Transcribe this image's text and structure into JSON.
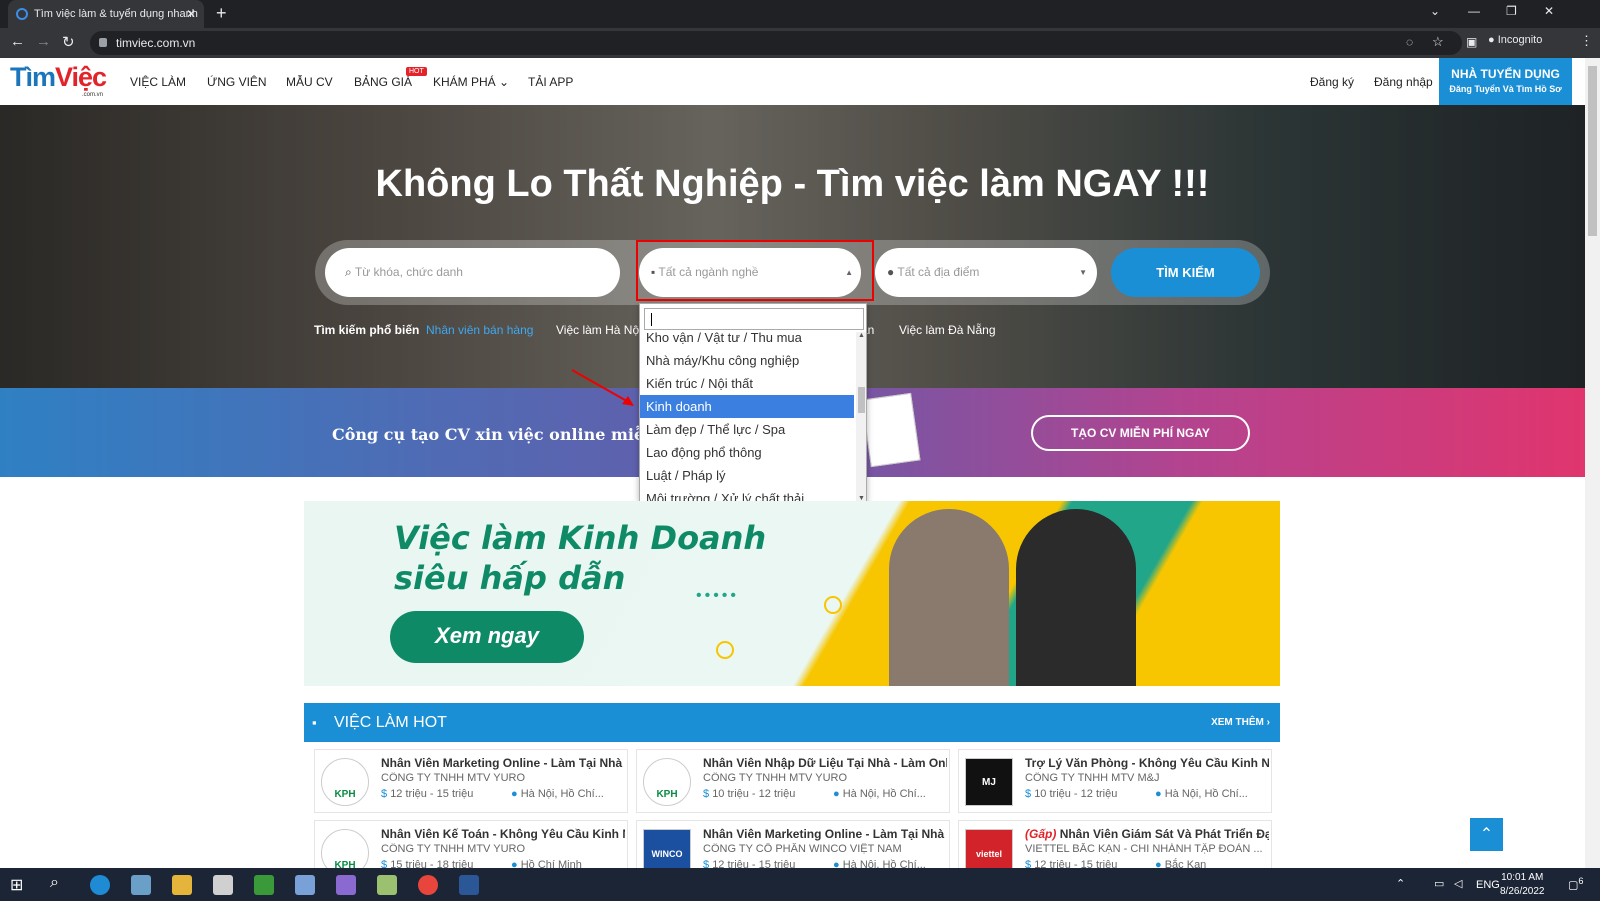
{
  "browser": {
    "tab_title": "Tìm việc làm & tuyển dụng nhanh",
    "tab_close": "✕",
    "new_tab": "+",
    "url": "timviec.com.vn",
    "incognito_label": "Incognito"
  },
  "header": {
    "logo_part1": "Tìm",
    "logo_part2": "Việc",
    "logo_sub": ".com.vn",
    "menu": [
      "VIỆC LÀM",
      "ỨNG VIÊN",
      "MẪU CV",
      "BẢNG GIÁ",
      "KHÁM PHÁ",
      "TẢI APP"
    ],
    "hot_badge": "HOT",
    "register": "Đăng ký",
    "login": "Đăng nhập",
    "employer_title": "NHÀ TUYỂN DỤNG",
    "employer_sub": "Đăng Tuyển Và Tìm Hồ Sơ"
  },
  "hero": {
    "title": "Không Lo Thất Nghiệp - Tìm việc làm NGAY !!!",
    "keyword_placeholder": "Từ khóa, chức danh",
    "industry_placeholder": "Tất cả ngành nghề",
    "location_placeholder": "Tất cả địa điểm",
    "search_button": "TÌM KIẾM",
    "popular_label": "Tìm kiếm phổ biến",
    "popular_links": [
      "Nhân viên bán hàng",
      "Việc làm Hà Nội",
      "ân",
      "Việc làm Đà Nẵng"
    ]
  },
  "industry_dropdown": {
    "items": [
      "Kho vận / Vật tư / Thu mua",
      "Nhà máy/Khu công nghiệp",
      "Kiến trúc / Nội thất",
      "Kinh doanh",
      "Làm đẹp / Thể lực / Spa",
      "Lao động phổ thông",
      "Luật / Pháp lý",
      "Môi trường / Xử lý chất thải"
    ],
    "selected_index": 3
  },
  "cv_banner": {
    "text": "Công cụ tạo CV xin việc online miễn phí,",
    "button": "TẠO CV MIỄN PHÍ NGAY"
  },
  "ad": {
    "line1": "Việc làm Kinh Doanh",
    "line2": "siêu hấp dẫn",
    "button": "Xem ngay"
  },
  "hot_jobs": {
    "title": "VIỆC LÀM HOT",
    "more": "XEM THÊM",
    "jobs": [
      {
        "title": "Nhân Viên Marketing Online - Làm Tại Nhà (...",
        "company": "CÔNG TY TNHH MTV YURO",
        "salary": "12 triệu - 15 triệu",
        "location": "Hà Nội, Hồ Chí...",
        "logo": "KPH"
      },
      {
        "title": "Nhân Viên Nhập Dữ Liệu Tại Nhà - Làm Onlin...",
        "company": "CÔNG TY TNHH MTV YURO",
        "salary": "10 triệu - 12 triệu",
        "location": "Hà Nội, Hồ Chí...",
        "logo": "KPH"
      },
      {
        "title": "Trợ Lý Văn Phòng - Không Yêu Cầu Kinh Ngh...",
        "company": "CÔNG TY TNHH MTV M&J",
        "salary": "10 triệu - 12 triệu",
        "location": "Hà Nội, Hồ Chí...",
        "logo": "MJ"
      },
      {
        "title": "Nhân Viên Kế Toán - Không Yêu Cầu Kinh Ng...",
        "company": "CÔNG TY TNHH MTV YURO",
        "salary": "15 triệu - 18 triệu",
        "location": "Hồ Chí Minh",
        "logo": "KPH"
      },
      {
        "title": "Nhân Viên Marketing Online - Làm Tại Nhà (...",
        "company": "CÔNG TY CỔ PHẦN WINCO VIỆT NAM",
        "salary": "12 triệu - 15 triệu",
        "location": "Hà Nội, Hồ Chí...",
        "logo": "WINCO"
      },
      {
        "title": "Nhân Viên Giám Sát Và Phát Triển Đại ...",
        "urgent": "(Gấp)",
        "company": "VIETTEL BẮC KẠN - CHI NHÁNH TẬP ĐOÀN ...",
        "salary": "12 triệu - 15 triệu",
        "location": "Bắc Kạn",
        "logo": "viettel"
      }
    ]
  },
  "taskbar": {
    "lang": "ENG",
    "time": "10:01 AM",
    "date": "8/26/2022",
    "notif_count": "6"
  },
  "colors": {
    "brand_blue": "#1a8fd6",
    "brand_red": "#e2232a",
    "dropdown_selected": "#3b80e0",
    "ad_green": "#0f8a66"
  }
}
